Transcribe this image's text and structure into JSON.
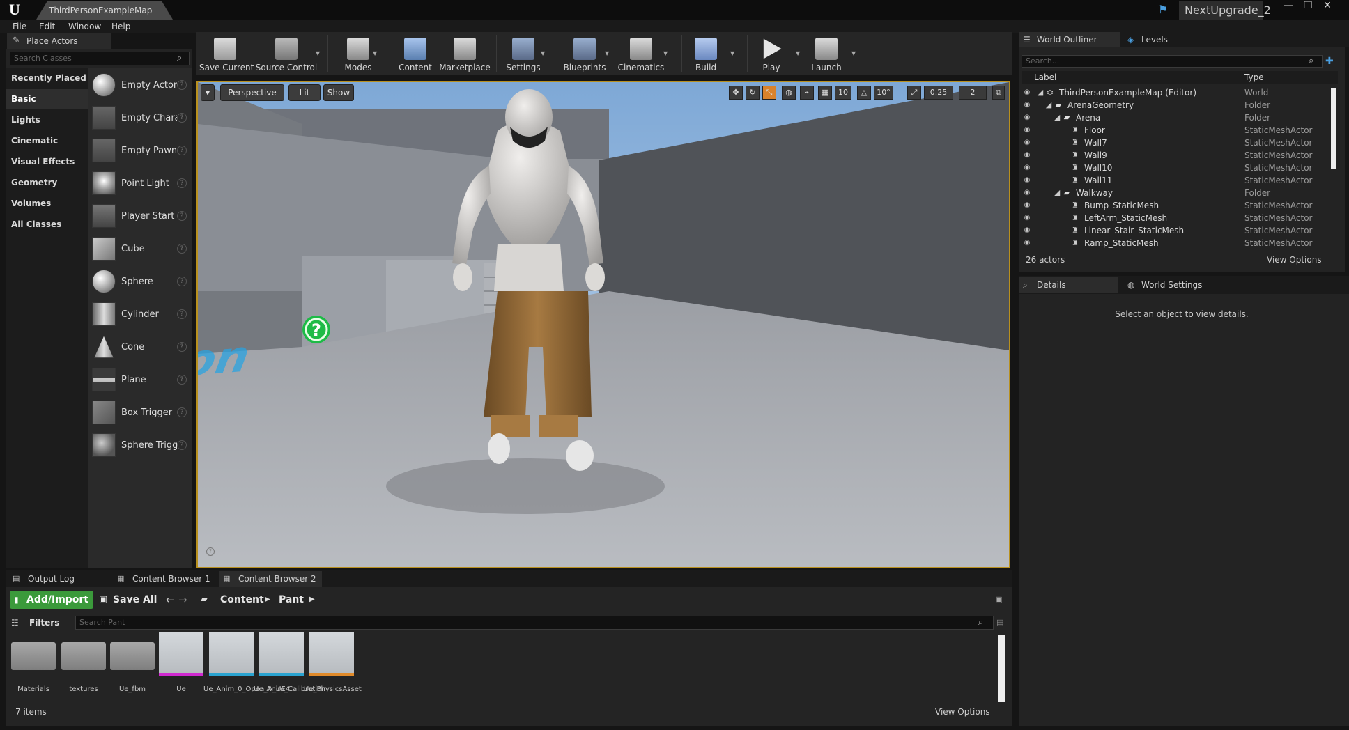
{
  "window": {
    "tab_title": "ThirdPersonExampleMap",
    "project_name": "NextUpgrade_2",
    "minimize": "—",
    "restore": "❐",
    "close": "✕"
  },
  "menu": [
    "File",
    "Edit",
    "Window",
    "Help"
  ],
  "place_actors": {
    "tab_label": "Place Actors",
    "search_placeholder": "Search Classes",
    "categories": [
      "Recently Placed",
      "Basic",
      "Lights",
      "Cinematic",
      "Visual Effects",
      "Geometry",
      "Volumes",
      "All Classes"
    ],
    "selected_category": "Basic",
    "actors": [
      "Empty Actor",
      "Empty Chara",
      "Empty Pawn",
      "Point Light",
      "Player Start",
      "Cube",
      "Sphere",
      "Cylinder",
      "Cone",
      "Plane",
      "Box Trigger",
      "Sphere Trigg"
    ]
  },
  "toolbar": {
    "buttons": [
      "Save Current",
      "Source Control",
      "Modes",
      "Content",
      "Marketplace",
      "Settings",
      "Blueprints",
      "Cinematics",
      "Build",
      "Play",
      "Launch"
    ]
  },
  "viewport": {
    "perspective": "Perspective",
    "lit": "Lit",
    "show": "Show",
    "grid_snap": "10",
    "rot_snap": "10°",
    "scale_snap": "0.25",
    "camera_speed": "2",
    "floor_text": "Person",
    "help_glyph": "?",
    "dropdown_glyph": "▾",
    "maximize_glyph": "⧉",
    "mini_glyph": "?"
  },
  "world_outliner": {
    "tab_label": "World Outliner",
    "levels_tab": "Levels",
    "search_placeholder": "Search...",
    "col_label": "Label",
    "col_type": "Type",
    "rows": [
      {
        "label": "ThirdPersonExampleMap (Editor)",
        "type": "World"
      },
      {
        "label": "ArenaGeometry",
        "type": "Folder"
      },
      {
        "label": "Arena",
        "type": "Folder"
      },
      {
        "label": "Floor",
        "type": "StaticMeshActor"
      },
      {
        "label": "Wall7",
        "type": "StaticMeshActor"
      },
      {
        "label": "Wall9",
        "type": "StaticMeshActor"
      },
      {
        "label": "Wall10",
        "type": "StaticMeshActor"
      },
      {
        "label": "Wall11",
        "type": "StaticMeshActor"
      },
      {
        "label": "Walkway",
        "type": "Folder"
      },
      {
        "label": "Bump_StaticMesh",
        "type": "StaticMeshActor"
      },
      {
        "label": "LeftArm_StaticMesh",
        "type": "StaticMeshActor"
      },
      {
        "label": "Linear_Stair_StaticMesh",
        "type": "StaticMeshActor"
      },
      {
        "label": "Ramp_StaticMesh",
        "type": "StaticMeshActor"
      }
    ],
    "count": "26 actors",
    "view_options": "View Options"
  },
  "details": {
    "tab_label": "Details",
    "world_settings_tab": "World Settings",
    "empty_message": "Select an object to view details."
  },
  "bottom": {
    "tabs": [
      "Output Log",
      "Content Browser 1",
      "Content Browser 2"
    ],
    "add_import": "Add/Import",
    "save_all": "Save All",
    "path": [
      "Content",
      "Pant"
    ],
    "filters": "Filters",
    "search_placeholder": "Search Pant",
    "assets": [
      {
        "name": "Materials",
        "kind": "folder"
      },
      {
        "name": "textures",
        "kind": "folder"
      },
      {
        "name": "Ue_fbm",
        "kind": "folder"
      },
      {
        "name": "Ue",
        "kind": "mesh"
      },
      {
        "name": "Ue_Anim_0_Open_A_UE4",
        "kind": "anim"
      },
      {
        "name": "Ue_Anim_Calibration",
        "kind": "anim"
      },
      {
        "name": "Ue_PhysicsAsset",
        "kind": "physics"
      }
    ],
    "item_count": "7 items",
    "view_options": "View Options"
  },
  "colors": {
    "viewport_border": "#b8901e",
    "accent_green": "#3b9a3b",
    "accent_blue": "#4a9fe0"
  }
}
